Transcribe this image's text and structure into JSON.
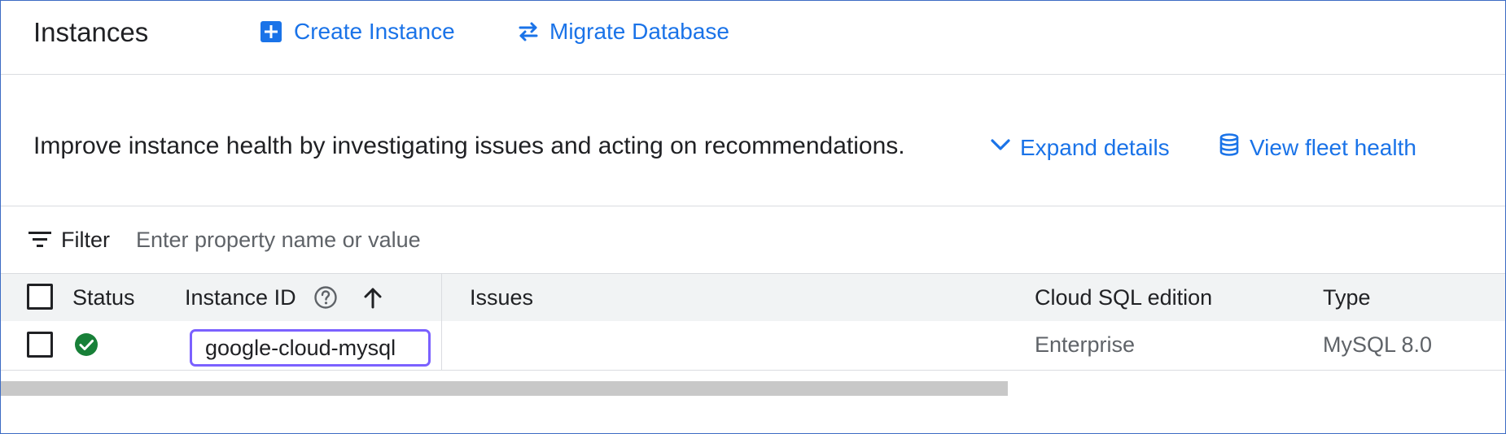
{
  "header": {
    "title": "Instances",
    "create_label": "Create Instance",
    "migrate_label": "Migrate Database"
  },
  "banner": {
    "text": "Improve instance health by investigating issues and acting on recommendations.",
    "expand_label": "Expand details",
    "fleet_label": "View fleet health"
  },
  "filter": {
    "label": "Filter",
    "placeholder": "Enter property name or value"
  },
  "table": {
    "columns": {
      "status": "Status",
      "instance_id": "Instance ID",
      "issues": "Issues",
      "edition": "Cloud SQL edition",
      "type": "Type"
    },
    "rows": [
      {
        "status": "ok",
        "instance_id": "google-cloud-mysql",
        "issues": "",
        "edition": "Enterprise",
        "type": "MySQL 8.0"
      }
    ]
  },
  "icons": {
    "create": "add-box-icon",
    "migrate": "swap-arrows-icon",
    "expand": "chevron-down-icon",
    "fleet": "database-icon",
    "filter": "filter-list-icon",
    "help": "help-circle-icon",
    "sort": "arrow-up-icon",
    "status_ok": "check-circle-icon"
  },
  "colors": {
    "accent": "#1a73e8",
    "status_ok": "#188038",
    "highlight": "#7b61ff"
  }
}
